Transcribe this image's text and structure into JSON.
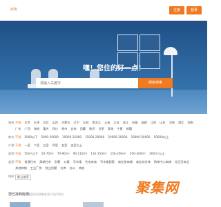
{
  "header": {
    "logo_text": "房房",
    "register_label": "注册",
    "login_label": "登录"
  },
  "hero": {
    "slogan": "嘿！您住的好一点！",
    "search_placeholder": "请输入关键字",
    "search_button": "搜房搜索"
  },
  "filters": {
    "region": {
      "label": "城市:",
      "options": [
        "不限",
        "北京",
        "天津",
        "河北",
        "山西",
        "内蒙古",
        "辽宁",
        "吉林",
        "黑龙江",
        "上海",
        "江苏",
        "浙江",
        "安徽",
        "福建",
        "江西",
        "山东",
        "河南",
        "湖北",
        "湖南",
        "广东",
        "广西",
        "海南",
        "重庆",
        "四川",
        "贵州",
        "云南",
        "西藏",
        "陕西",
        "甘肃",
        "青海",
        "宁夏",
        "新疆"
      ]
    },
    "price": {
      "label": "售价:",
      "options": [
        "不限",
        "5000以下",
        "5000-10000",
        "10000-15000",
        "15000-20000",
        "20000-30000",
        "30000-50000",
        "50000以上"
      ]
    },
    "layout": {
      "label": "户型:",
      "options": [
        "不限",
        "一室",
        "二室",
        "三室",
        "四室",
        "五室",
        "五室以上"
      ]
    },
    "area": {
      "label": "面积:",
      "options": [
        "不限",
        "50m²以下",
        "50-70m²",
        "70-90m²",
        "90-110m²",
        "110-150m²",
        "150-200m²",
        "200-300m²",
        "300m²以上"
      ]
    },
    "type": {
      "label": "类型:",
      "options": [
        "不限",
        "普通住宅",
        "高端住宅",
        "别墅",
        "公寓",
        "写字楼",
        "住宅底商",
        "写字楼配套",
        "商业街商铺",
        "商业综合体",
        "购物中心商铺",
        "社区型商业",
        "其他商铺",
        "工业厂房",
        "独立别墅",
        "仓库",
        "办公",
        "商务"
      ]
    },
    "sort": {
      "label": "排序:",
      "value": "默认排序"
    }
  },
  "listing": {
    "title": "您已找到房源:",
    "subtitle": "楼盘信息收集来源于合作网站"
  },
  "watermark": "聚集网",
  "colors": {
    "accent": "#f07a22",
    "hero_blue": "#2f6aa3"
  }
}
